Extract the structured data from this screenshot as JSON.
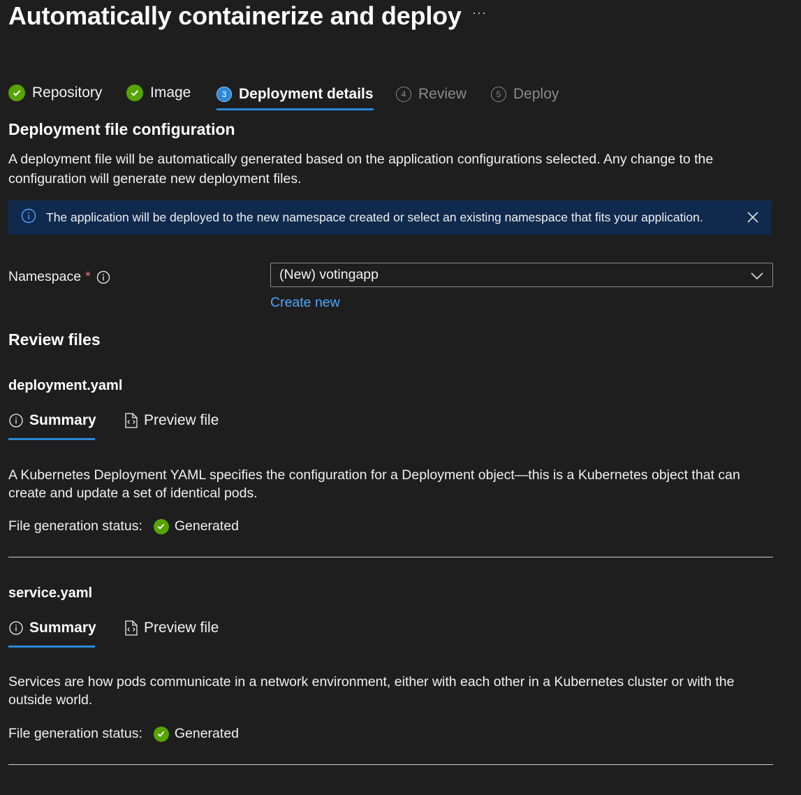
{
  "header": {
    "title": "Automatically containerize and deploy",
    "more_label": "···"
  },
  "steps": [
    {
      "label": "Repository",
      "state": "done"
    },
    {
      "label": "Image",
      "state": "done"
    },
    {
      "label": "Deployment details",
      "state": "current",
      "number": "3"
    },
    {
      "label": "Review",
      "state": "future",
      "number": "4"
    },
    {
      "label": "Deploy",
      "state": "future",
      "number": "5"
    }
  ],
  "config": {
    "heading": "Deployment file configuration",
    "description": "A deployment file will be automatically generated based on the application configurations selected. Any change to the configuration will generate new deployment files.",
    "info_message": "The application will be deployed to the new namespace created or select an existing namespace that fits your application."
  },
  "namespace": {
    "label": "Namespace",
    "required_mark": "*",
    "selected_value": "(New) votingapp",
    "create_new_label": "Create new"
  },
  "review": {
    "heading": "Review files",
    "files": [
      {
        "name": "deployment.yaml",
        "tabs": {
          "summary": "Summary",
          "preview": "Preview file"
        },
        "description": "A Kubernetes Deployment YAML specifies the configuration for a Deployment object—this is a Kubernetes object that can create and update a set of identical pods.",
        "status_label": "File generation status:",
        "status_value": "Generated"
      },
      {
        "name": "service.yaml",
        "tabs": {
          "summary": "Summary",
          "preview": "Preview file"
        },
        "description": "Services are how pods communicate in a network environment, either with each other in a Kubernetes cluster or with the outside world.",
        "status_label": "File generation status:",
        "status_value": "Generated"
      }
    ]
  },
  "colors": {
    "background": "#1e1e1e",
    "accent": "#2b88d8",
    "success": "#57a300",
    "link": "#4da6ff",
    "info_bar": "#0f2a4d",
    "required": "#f1707b"
  }
}
